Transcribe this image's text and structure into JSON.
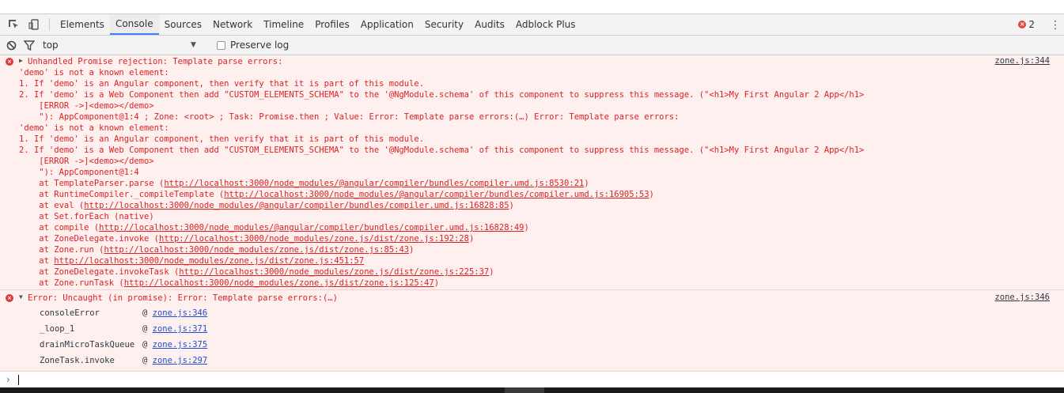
{
  "toolbar": {
    "tabs": [
      "Elements",
      "Console",
      "Sources",
      "Network",
      "Timeline",
      "Profiles",
      "Application",
      "Security",
      "Audits",
      "Adblock Plus"
    ],
    "active_tab": "Console",
    "error_count": "2"
  },
  "filter": {
    "context": "top",
    "preserve_log_label": "Preserve log"
  },
  "message1": {
    "source": "zone.js:344",
    "lines": [
      "Unhandled Promise rejection: Template parse errors:",
      "'demo' is not a known element:",
      "1. If 'demo' is an Angular component, then verify that it is part of this module.",
      "2. If 'demo' is a Web Component then add \"CUSTOM_ELEMENTS_SCHEMA\" to the '@NgModule.schema' of this component to suppress this message. (\"<h1>My First Angular 2 App</h1>",
      "    [ERROR ->]<demo></demo>",
      "    \"): AppComponent@1:4 ; Zone: <root> ; Task: Promise.then ; Value: Error: Template parse errors:(…) Error: Template parse errors:",
      "'demo' is not a known element:",
      "1. If 'demo' is an Angular component, then verify that it is part of this module.",
      "2. If 'demo' is a Web Component then add \"CUSTOM_ELEMENTS_SCHEMA\" to the '@NgModule.schema' of this component to suppress this message. (\"<h1>My First Angular 2 App</h1>",
      "    [ERROR ->]<demo></demo>",
      "    \"): AppComponent@1:4"
    ],
    "stack": [
      {
        "prefix": "    at TemplateParser.parse (",
        "url": "http://localhost:3000/node_modules/@angular/compiler/bundles/compiler.umd.js:8530:21",
        "suffix": ")"
      },
      {
        "prefix": "    at RuntimeCompiler._compileTemplate (",
        "url": "http://localhost:3000/node_modules/@angular/compiler/bundles/compiler.umd.js:16905:53",
        "suffix": ")"
      },
      {
        "prefix": "    at eval (",
        "url": "http://localhost:3000/node_modules/@angular/compiler/bundles/compiler.umd.js:16828:85",
        "suffix": ")"
      },
      {
        "prefix": "    at Set.forEach (native)",
        "url": "",
        "suffix": ""
      },
      {
        "prefix": "    at compile (",
        "url": "http://localhost:3000/node_modules/@angular/compiler/bundles/compiler.umd.js:16828:49",
        "suffix": ")"
      },
      {
        "prefix": "    at ZoneDelegate.invoke (",
        "url": "http://localhost:3000/node_modules/zone.js/dist/zone.js:192:28",
        "suffix": ")"
      },
      {
        "prefix": "    at Zone.run (",
        "url": "http://localhost:3000/node_modules/zone.js/dist/zone.js:85:43",
        "suffix": ")"
      },
      {
        "prefix": "    at ",
        "url": "http://localhost:3000/node_modules/zone.js/dist/zone.js:451:57",
        "suffix": ""
      },
      {
        "prefix": "    at ZoneDelegate.invokeTask (",
        "url": "http://localhost:3000/node_modules/zone.js/dist/zone.js:225:37",
        "suffix": ")"
      },
      {
        "prefix": "    at Zone.runTask (",
        "url": "http://localhost:3000/node_modules/zone.js/dist/zone.js:125:47",
        "suffix": ")"
      }
    ]
  },
  "message2": {
    "source": "zone.js:346",
    "text": "Error: Uncaught (in promise): Error: Template parse errors:(…)",
    "trace": [
      {
        "fn": "consoleError",
        "loc": "zone.js:346"
      },
      {
        "fn": "_loop_1",
        "loc": "zone.js:371"
      },
      {
        "fn": "drainMicroTaskQueue",
        "loc": "zone.js:375"
      },
      {
        "fn": "ZoneTask.invoke",
        "loc": "zone.js:297"
      }
    ]
  },
  "colors": {
    "error_text": "#e02020",
    "error_bg": "#fff0f0",
    "active_tab": "#3e82f7",
    "link": "#1a4fd6"
  }
}
